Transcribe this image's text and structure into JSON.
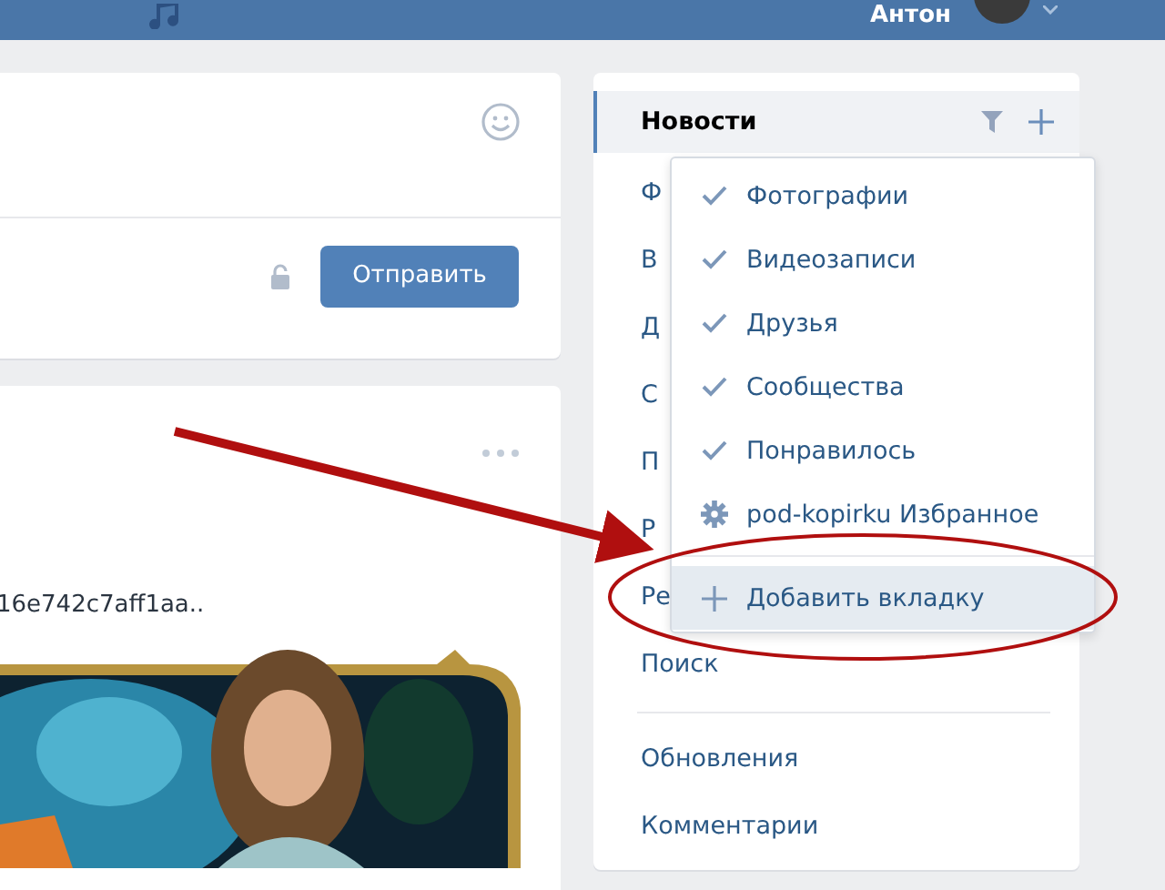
{
  "top_bar": {
    "user_name": "Антон"
  },
  "composer": {
    "send_button": "Отправить"
  },
  "post": {
    "text": "16e742c7aff1aa.."
  },
  "sidebar": {
    "items": [
      {
        "label": "Новости",
        "selected": true
      },
      {
        "label": "Ф",
        "selected": false
      },
      {
        "label": "В",
        "selected": false
      },
      {
        "label": "Д",
        "selected": false
      },
      {
        "label": "С",
        "selected": false
      },
      {
        "label": "П",
        "selected": false
      },
      {
        "label": "Р",
        "selected": false
      },
      {
        "label": "Ре",
        "selected": false
      },
      {
        "label": "Поиск",
        "selected": false
      }
    ],
    "secondary_items": [
      {
        "label": "Обновления",
        "selected": false
      },
      {
        "label": "Комментарии",
        "selected": false
      }
    ]
  },
  "dropdown": {
    "items": [
      {
        "kind": "check",
        "label": "Фотографии",
        "checked": true
      },
      {
        "kind": "check",
        "label": "Видеозаписи",
        "checked": true
      },
      {
        "kind": "check",
        "label": "Друзья",
        "checked": true
      },
      {
        "kind": "check",
        "label": "Сообщества",
        "checked": true
      },
      {
        "kind": "check",
        "label": "Понравилось",
        "checked": true
      },
      {
        "kind": "gear",
        "label": "pod-kopirku Избранное"
      }
    ],
    "add_tab": {
      "label": "Добавить вкладку",
      "highlighted": true
    }
  },
  "annotations": {
    "arrow": true,
    "ellipse": true
  }
}
